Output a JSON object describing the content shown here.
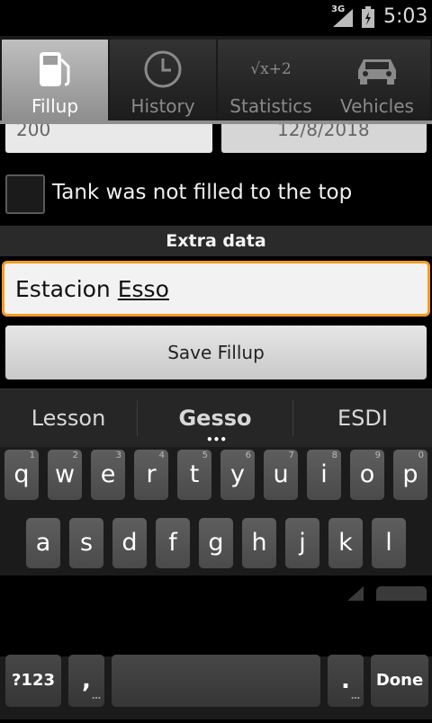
{
  "status_bar": {
    "network": "3G",
    "time": "5:03"
  },
  "tabs": [
    {
      "label": "Fillup",
      "icon": "fuel-pump-icon",
      "active": true
    },
    {
      "label": "History",
      "icon": "clock-icon",
      "active": false
    },
    {
      "label": "Statistics",
      "icon": "formula-icon",
      "formula": "√x+2",
      "active": false
    },
    {
      "label": "Vehicles",
      "icon": "car-icon",
      "active": false
    }
  ],
  "partial_fields": {
    "left_value": "200",
    "right_value": "12/8/2018"
  },
  "tank_checkbox": {
    "label": "Tank was not filled to the top",
    "checked": false
  },
  "extra_data": {
    "header": "Extra data"
  },
  "station_input": {
    "value_prefix": "Estacion ",
    "value_underlined": "Esso"
  },
  "save_button": {
    "label": "Save Fillup"
  },
  "keyboard": {
    "suggestions": [
      "Lesson",
      "Gesso",
      "ESDI"
    ],
    "row1": [
      {
        "k": "q",
        "h": "1"
      },
      {
        "k": "w",
        "h": "2"
      },
      {
        "k": "e",
        "h": "3"
      },
      {
        "k": "r",
        "h": "4"
      },
      {
        "k": "t",
        "h": "5"
      },
      {
        "k": "y",
        "h": "6"
      },
      {
        "k": "u",
        "h": "7"
      },
      {
        "k": "i",
        "h": "8"
      },
      {
        "k": "o",
        "h": "9"
      },
      {
        "k": "p",
        "h": "0"
      }
    ],
    "row2": [
      "a",
      "s",
      "d",
      "f",
      "g",
      "h",
      "j",
      "k",
      "l"
    ],
    "symbols_key": "?123",
    "comma_key": ",",
    "period_key": ".",
    "done_key": "Done"
  }
}
